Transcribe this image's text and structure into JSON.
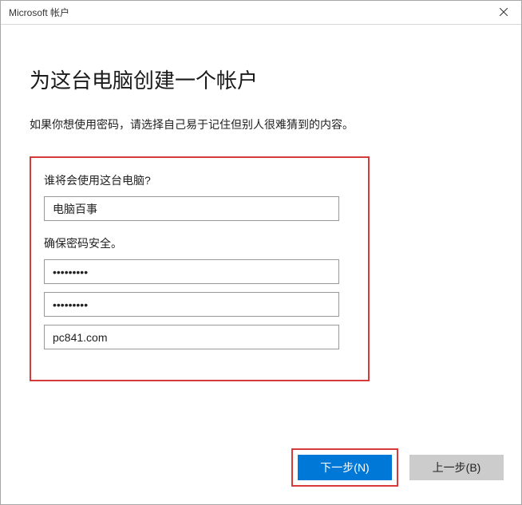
{
  "window": {
    "title": "Microsoft 帐户"
  },
  "page": {
    "heading": "为这台电脑创建一个帐户",
    "subtext": "如果你想使用密码，请选择自己易于记住但别人很难猜到的内容。"
  },
  "form": {
    "username_label": "谁将会使用这台电脑?",
    "username_value": "电脑百事",
    "password_section_label": "确保密码安全。",
    "password_value": "•••••••••",
    "confirm_value": "•••••••••",
    "hint_value": "pc841.com"
  },
  "buttons": {
    "next": "下一步(N)",
    "back": "上一步(B)"
  }
}
